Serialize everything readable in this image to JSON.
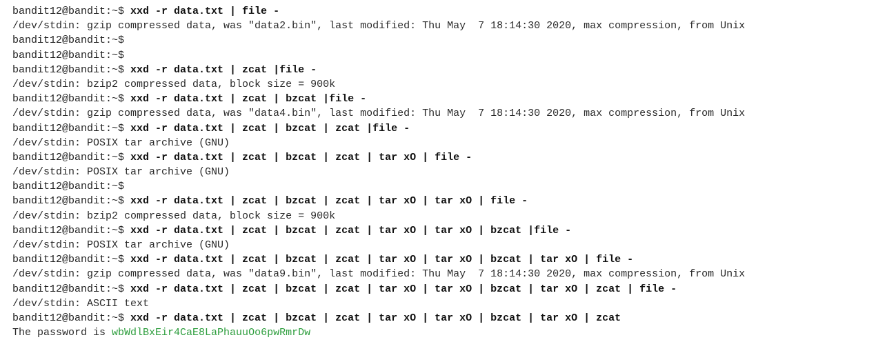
{
  "colors": {
    "background": "#ffffff",
    "text": "#1f1f1f",
    "password": "#2e9e3e"
  },
  "terminal": {
    "lines": [
      {
        "type": "cmd",
        "prompt": "bandit12@bandit:~$ ",
        "cmd": "xxd -r data.txt | file -"
      },
      {
        "type": "out",
        "text": "/dev/stdin: gzip compressed data, was \"data2.bin\", last modified: Thu May  7 18:14:30 2020, max compression, from Unix"
      },
      {
        "type": "cmd",
        "prompt": "bandit12@bandit:~$",
        "cmd": ""
      },
      {
        "type": "cmd",
        "prompt": "bandit12@bandit:~$",
        "cmd": ""
      },
      {
        "type": "cmd",
        "prompt": "bandit12@bandit:~$ ",
        "cmd": "xxd -r data.txt | zcat |file -"
      },
      {
        "type": "out",
        "text": "/dev/stdin: bzip2 compressed data, block size = 900k"
      },
      {
        "type": "cmd",
        "prompt": "bandit12@bandit:~$ ",
        "cmd": "xxd -r data.txt | zcat | bzcat |file -"
      },
      {
        "type": "out",
        "text": "/dev/stdin: gzip compressed data, was \"data4.bin\", last modified: Thu May  7 18:14:30 2020, max compression, from Unix"
      },
      {
        "type": "cmd",
        "prompt": "bandit12@bandit:~$ ",
        "cmd": "xxd -r data.txt | zcat | bzcat | zcat |file -"
      },
      {
        "type": "out",
        "text": "/dev/stdin: POSIX tar archive (GNU)"
      },
      {
        "type": "cmd",
        "prompt": "bandit12@bandit:~$ ",
        "cmd": "xxd -r data.txt | zcat | bzcat | zcat | tar xO | file -"
      },
      {
        "type": "out",
        "text": "/dev/stdin: POSIX tar archive (GNU)"
      },
      {
        "type": "cmd",
        "prompt": "bandit12@bandit:~$",
        "cmd": ""
      },
      {
        "type": "cmd",
        "prompt": "bandit12@bandit:~$ ",
        "cmd": "xxd -r data.txt | zcat | bzcat | zcat | tar xO | tar xO | file -"
      },
      {
        "type": "out",
        "text": "/dev/stdin: bzip2 compressed data, block size = 900k"
      },
      {
        "type": "cmd",
        "prompt": "bandit12@bandit:~$ ",
        "cmd": "xxd -r data.txt | zcat | bzcat | zcat | tar xO | tar xO | bzcat |file -"
      },
      {
        "type": "out",
        "text": "/dev/stdin: POSIX tar archive (GNU)"
      },
      {
        "type": "cmd",
        "prompt": "bandit12@bandit:~$ ",
        "cmd": "xxd -r data.txt | zcat | bzcat | zcat | tar xO | tar xO | bzcat | tar xO | file -"
      },
      {
        "type": "out",
        "text": "/dev/stdin: gzip compressed data, was \"data9.bin\", last modified: Thu May  7 18:14:30 2020, max compression, from Unix"
      },
      {
        "type": "cmd",
        "prompt": "bandit12@bandit:~$ ",
        "cmd": "xxd -r data.txt | zcat | bzcat | zcat | tar xO | tar xO | bzcat | tar xO | zcat | file -"
      },
      {
        "type": "out",
        "text": "/dev/stdin: ASCII text"
      },
      {
        "type": "cmd",
        "prompt": "bandit12@bandit:~$ ",
        "cmd": "xxd -r data.txt | zcat | bzcat | zcat | tar xO | tar xO | bzcat | tar xO | zcat"
      },
      {
        "type": "pw",
        "text": "The password is ",
        "password": "wbWdlBxEir4CaE8LaPhauuOo6pwRmrDw"
      }
    ]
  }
}
